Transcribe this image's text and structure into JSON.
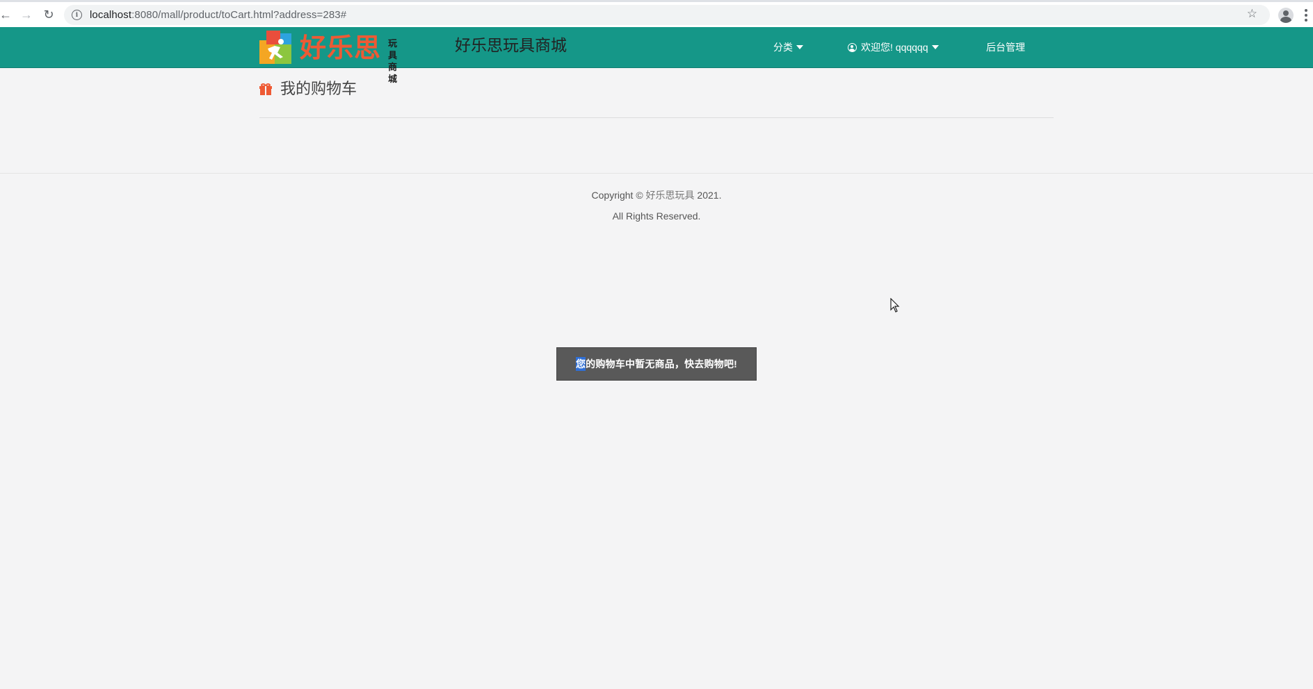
{
  "browser": {
    "url_host": "localhost",
    "url_rest": ":8080/mall/product/toCart.html?address=283#"
  },
  "header": {
    "logo_brand": "好乐思",
    "logo_sub_line1": "玩 具",
    "logo_sub_line2": "商 城",
    "site_title": "好乐思玩具商城",
    "nav": {
      "category": "分类",
      "welcome": "欢迎您! qqqqqq",
      "admin": "后台管理"
    }
  },
  "main": {
    "heading": "我的购物车"
  },
  "footer": {
    "copyright_prefix": "Copyright © ",
    "brand": "好乐思玩具",
    "copyright_suffix": " 2021.",
    "rights": "All Rights Reserved."
  },
  "toast": {
    "first_char": "您",
    "message_rest": "的购物车中暂无商品，快去购物吧!"
  },
  "colors": {
    "header_bg": "#159788",
    "accent": "#ee5a34",
    "toast_bg": "#595959",
    "page_bg": "#f4f4f5"
  }
}
